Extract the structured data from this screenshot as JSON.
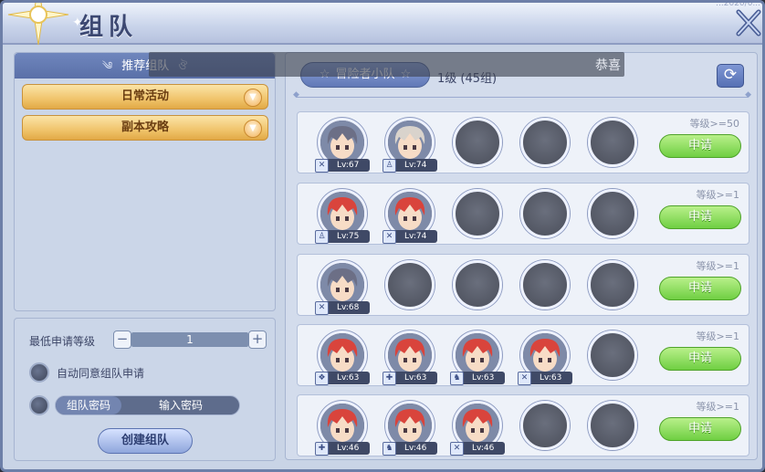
{
  "window": {
    "title": "组队",
    "corner_text": "...2020/0..."
  },
  "left_panel": {
    "recommend_header": "推荐组队",
    "categories": [
      {
        "label": "日常活动"
      },
      {
        "label": "副本攻略"
      }
    ],
    "min_level_label": "最低申请等级",
    "min_level_value": "1",
    "stepper_minus": "−",
    "stepper_plus": "+",
    "auto_accept_label": "自动同意组队申请",
    "password_tag": "组队密码",
    "password_placeholder": "输入密码",
    "create_button": "创建组队"
  },
  "right_panel": {
    "team_tab": "冒险者小队",
    "level_info": "1级   (45组)",
    "refresh_icon": "refresh-icon",
    "teams": [
      {
        "requirement": "等级>=50",
        "apply": "申请",
        "members": [
          {
            "level": "Lv:67",
            "hair": "#6c6f86"
          },
          {
            "level": "Lv:74",
            "hair": "#d9d3cc"
          },
          null,
          null,
          null
        ]
      },
      {
        "requirement": "等级>=1",
        "apply": "申请",
        "members": [
          {
            "level": "Lv:75",
            "hair": "#d9443c"
          },
          {
            "level": "Lv:74",
            "hair": "#d9443c"
          },
          null,
          null,
          null
        ]
      },
      {
        "requirement": "等级>=1",
        "apply": "申请",
        "members": [
          {
            "level": "Lv:68",
            "hair": "#6c6f86"
          },
          null,
          null,
          null,
          null
        ]
      },
      {
        "requirement": "等级>=1",
        "apply": "申请",
        "members": [
          {
            "level": "Lv:63",
            "hair": "#d9443c"
          },
          {
            "level": "Lv:63",
            "hair": "#d9443c"
          },
          {
            "level": "Lv:63",
            "hair": "#d9443c"
          },
          {
            "level": "Lv:63",
            "hair": "#d9443c"
          },
          null
        ]
      },
      {
        "requirement": "等级>=1",
        "apply": "申请",
        "members": [
          {
            "level": "Lv:46",
            "hair": "#d9443c"
          },
          {
            "level": "Lv:46",
            "hair": "#d9443c"
          },
          {
            "level": "Lv:46",
            "hair": "#d9443c"
          },
          null,
          null
        ]
      }
    ]
  },
  "toast": {
    "text": "恭喜"
  },
  "colors": {
    "accent": "#5a70a8",
    "apply_green": "#6fcf42",
    "category_gold": "#f0c46b"
  }
}
